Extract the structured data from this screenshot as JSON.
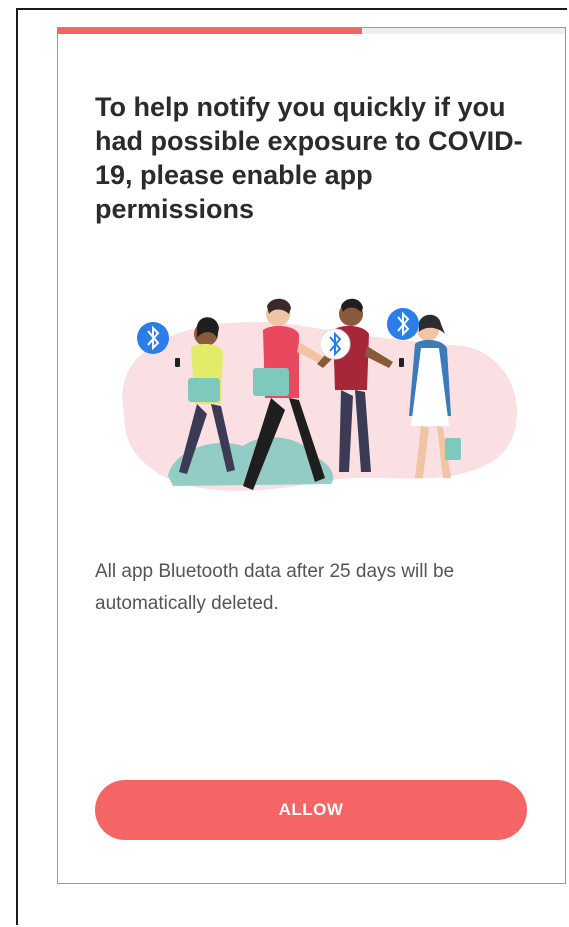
{
  "onboarding": {
    "progress": 0.6,
    "title": "To help notify you quickly if you had possible exposure to COVID-19, please enable app permissions",
    "body": "All app Bluetooth data after 25 days will be automatically deleted.",
    "allow_label": "ALLOW",
    "illustration": {
      "icons": [
        "bluetooth-icon",
        "bluetooth-icon",
        "bluetooth-icon"
      ]
    }
  },
  "colors": {
    "accent": "#f56565",
    "progress_fill": "#f26464",
    "progress_track": "#eeeeee",
    "blob": "#fbe0e3",
    "bluetooth_bubble": "#2b7de9",
    "title_text": "#2b2b2b",
    "body_text": "#555555"
  }
}
